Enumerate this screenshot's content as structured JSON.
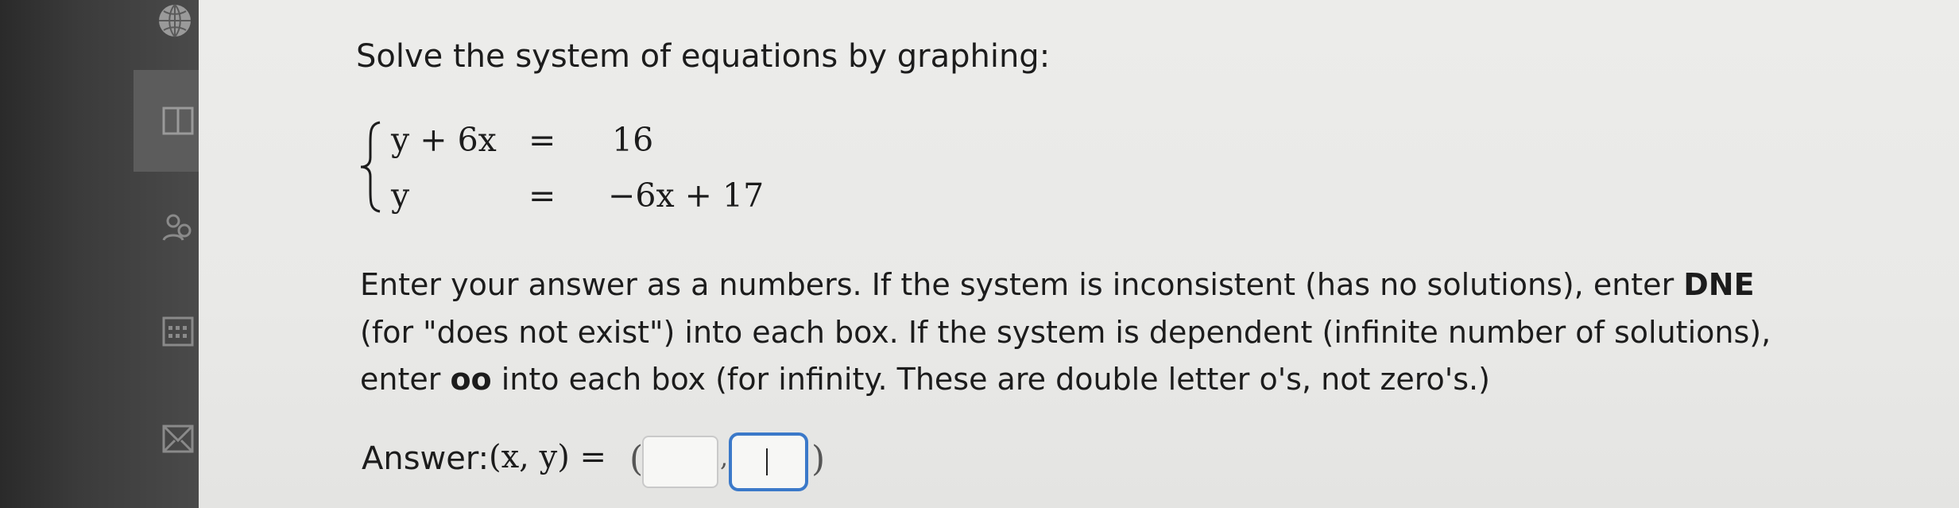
{
  "question": {
    "title": "Solve the system of equations by graphing:",
    "system": {
      "row1": {
        "lhs": "y + 6x",
        "eq": "=",
        "rhs": "16"
      },
      "row2": {
        "lhs": "y",
        "eq": "=",
        "rhs": "−6x + 17"
      }
    },
    "instructions": {
      "p1_pre": "Enter your answer as a numbers. If the system is inconsistent (has no solutions), enter ",
      "p1_bold": "DNE",
      "p2": "(for \"does not exist\") into each box. If the system is dependent (infinite number of solutions),",
      "p3_pre": "enter ",
      "p3_bold": "oo",
      "p3_post": " into each box (for infinity. These are double letter o's, not zero's.)"
    }
  },
  "answer": {
    "label": "Answer:",
    "lhs": "(x, y) =",
    "open_paren": "(",
    "comma": ",",
    "close_paren": ")",
    "x_value": "",
    "y_value": ""
  }
}
